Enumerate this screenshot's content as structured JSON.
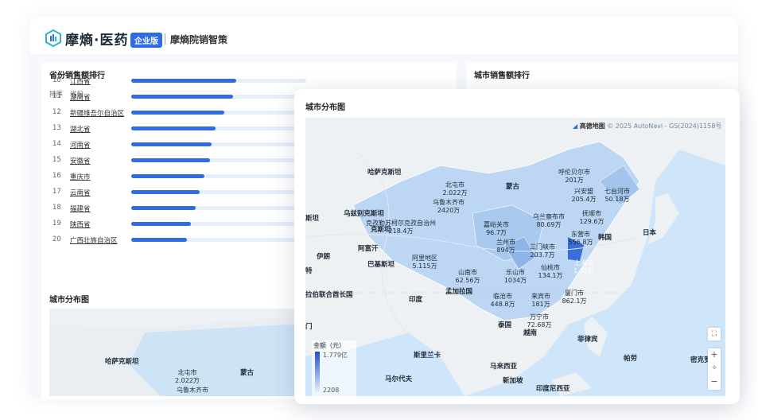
{
  "header": {
    "brand": "摩熵·医药",
    "edition": "企业版",
    "product": "摩熵院销智策"
  },
  "province_card": {
    "title": "省份销售额排行",
    "col_rank": "排序",
    "col_province": "省份",
    "rows": [
      {
        "rank": "10",
        "name": "江西省",
        "share": 0.6
      },
      {
        "rank": "11",
        "name": "湖南省",
        "share": 0.58
      },
      {
        "rank": "12",
        "name": "新疆维吾尔自治区",
        "share": 0.53
      },
      {
        "rank": "13",
        "name": "湖北省",
        "share": 0.48
      },
      {
        "rank": "14",
        "name": "河南省",
        "share": 0.46
      },
      {
        "rank": "15",
        "name": "安徽省",
        "share": 0.45
      },
      {
        "rank": "16",
        "name": "重庆市",
        "share": 0.42
      },
      {
        "rank": "17",
        "name": "云南省",
        "share": 0.39
      },
      {
        "rank": "18",
        "name": "福建省",
        "share": 0.37
      },
      {
        "rank": "19",
        "name": "陕西省",
        "share": 0.34
      },
      {
        "rank": "20",
        "name": "广西壮族自治区",
        "share": 0.32
      }
    ]
  },
  "city_rank_card": {
    "title": "城市销售额排行"
  },
  "bg_map_card": {
    "title": "城市分布图",
    "labels": [
      {
        "id": "kz",
        "text": "哈萨克斯坦"
      },
      {
        "id": "beitun",
        "text": "北屯市\n2.022万"
      },
      {
        "id": "mongolia",
        "text": "蒙古"
      },
      {
        "id": "urumqi",
        "text": "乌鲁木齐市"
      }
    ]
  },
  "map_popup": {
    "title": "城市分布图",
    "attribution": "© 2025 AutoNavi - GS(2024)1158号",
    "provider": "高德地图",
    "legend": {
      "title": "金额（元）",
      "max": "1.779亿",
      "min": "2208"
    },
    "zoom_in": "+",
    "zoom_out": "−",
    "compass": "✧",
    "fullscreen": "⛶",
    "countries": [
      {
        "id": "kazakhstan",
        "text": "哈萨克斯坦"
      },
      {
        "id": "mongolia",
        "text": "蒙古"
      },
      {
        "id": "uzbekistan",
        "text": "乌兹别克斯坦"
      },
      {
        "id": "turkmen",
        "text": "斯坦"
      },
      {
        "id": "kyrgyz",
        "text": "克斯坦"
      },
      {
        "id": "afghanistan",
        "text": "阿富汗"
      },
      {
        "id": "iran",
        "text": "伊朗"
      },
      {
        "id": "pakistan",
        "text": "巴基斯坦"
      },
      {
        "id": "india",
        "text": "印度"
      },
      {
        "id": "bangladesh",
        "text": "孟加拉国"
      },
      {
        "id": "uae",
        "text": "拉伯联合酋长国"
      },
      {
        "id": "korea",
        "text": "韩国"
      },
      {
        "id": "japan",
        "text": "日本"
      },
      {
        "id": "thailand",
        "text": "泰国"
      },
      {
        "id": "vietnam",
        "text": "越南"
      },
      {
        "id": "philippines",
        "text": "菲律宾"
      },
      {
        "id": "srilanka",
        "text": "斯里兰卡"
      },
      {
        "id": "maldives",
        "text": "马尔代夫"
      },
      {
        "id": "malaysia",
        "text": "马来西亚"
      },
      {
        "id": "singapore",
        "text": "新加坡"
      },
      {
        "id": "indonesia",
        "text": "印度尼西亚"
      },
      {
        "id": "palau",
        "text": "帕劳"
      },
      {
        "id": "micronesia",
        "text": "密克罗尼"
      },
      {
        "id": "left1",
        "text": "特"
      },
      {
        "id": "left2",
        "text": "门"
      }
    ],
    "cities": [
      {
        "id": "beitun",
        "name": "北屯市",
        "value": "2.022万"
      },
      {
        "id": "urumqi",
        "name": "乌鲁木齐市",
        "value": "2420万"
      },
      {
        "id": "kizilsu",
        "name": "克孜勒苏柯尔克孜自治州",
        "value": "218.4万"
      },
      {
        "id": "hulunbuir",
        "name": "呼伦贝尔市",
        "value": "201万"
      },
      {
        "id": "xinganmeng",
        "name": "兴安盟",
        "value": "205.4万"
      },
      {
        "id": "qitaihe",
        "name": "七台河市",
        "value": "50.18万"
      },
      {
        "id": "fushun",
        "name": "抚顺市",
        "value": "129.6万"
      },
      {
        "id": "wulanchabu",
        "name": "乌兰察布市",
        "value": "80.69万"
      },
      {
        "id": "jiayuguan",
        "name": "嘉峪关市",
        "value": "96.7万"
      },
      {
        "id": "dongying",
        "name": "东营市",
        "value": "556.8万"
      },
      {
        "id": "lanzhou",
        "name": "兰州市",
        "value": "894万"
      },
      {
        "id": "sanmenxia",
        "name": "三门峡市",
        "value": "203.7万"
      },
      {
        "id": "shanghai",
        "name": "上海市",
        "value": "1.37亿"
      },
      {
        "id": "ali",
        "name": "阿里地区",
        "value": "5.115万"
      },
      {
        "id": "shannan",
        "name": "山南市",
        "value": "62.56万"
      },
      {
        "id": "leshan",
        "name": "乐山市",
        "value": "1034万"
      },
      {
        "id": "xiantao",
        "name": "仙桃市",
        "value": "134.1万"
      },
      {
        "id": "lincang",
        "name": "临沧市",
        "value": "448.8万"
      },
      {
        "id": "laibin",
        "name": "来宾市",
        "value": "181万"
      },
      {
        "id": "xiamen",
        "name": "厦门市",
        "value": "862.1万"
      },
      {
        "id": "wanning",
        "name": "万宁市",
        "value": "72.68万"
      }
    ]
  }
}
